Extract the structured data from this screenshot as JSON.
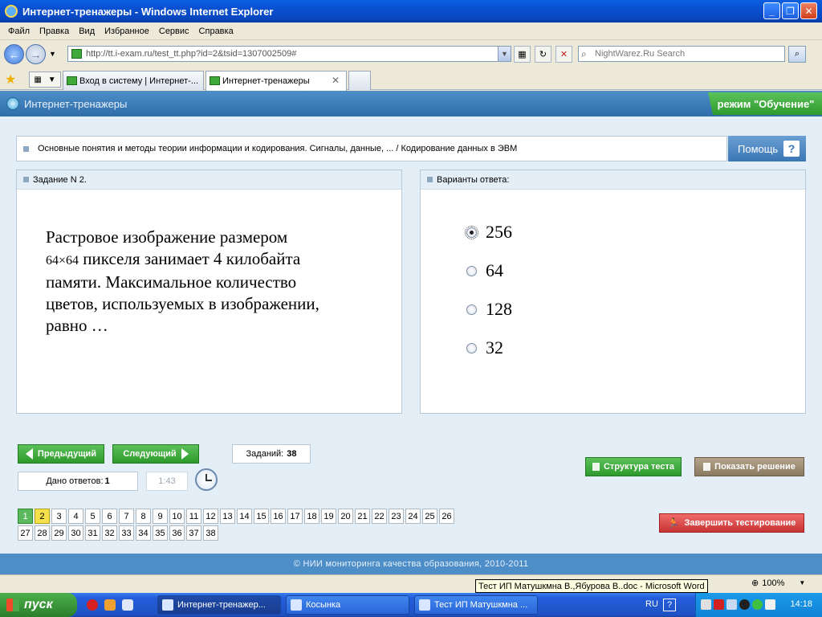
{
  "window": {
    "title": "Интернет-тренажеры - Windows Internet Explorer"
  },
  "menu": [
    "Файл",
    "Правка",
    "Вид",
    "Избранное",
    "Сервис",
    "Справка"
  ],
  "address": {
    "url": "http://tt.i-exam.ru/test_tt.php?id=2&tsid=1307002509#"
  },
  "search": {
    "placeholder": "NightWarez.Ru Search"
  },
  "tabs": [
    {
      "label": "Вход в систему | Интернет-..."
    },
    {
      "label": "Интернет-тренажеры"
    }
  ],
  "app": {
    "title": "Интернет-тренажеры",
    "mode": "режим \"Обучение\"",
    "breadcrumb": "Основные понятия и методы теории информации и кодирования. Сигналы, данные, ... / Кодирование данных в ЭВМ",
    "help": "Помощь",
    "help_icon": "?"
  },
  "task": {
    "header": "Задание N 2.",
    "text_line1": "Растровое изображение размером",
    "dim": "64×64",
    "text_rest1": " пикселя занимает 4 килобайта",
    "text_line3": "памяти. Максимальное количество",
    "text_line4": "цветов, используемых в изображении,",
    "text_line5": "равно …"
  },
  "answers": {
    "header": "Варианты ответа:",
    "options": [
      {
        "label": "256",
        "checked": true
      },
      {
        "label": "64",
        "checked": false
      },
      {
        "label": "128",
        "checked": false
      },
      {
        "label": "32",
        "checked": false
      }
    ]
  },
  "controls": {
    "prev": "Предыдущий",
    "next": "Следующий",
    "tasks_label": "Заданий:",
    "tasks_count": "38",
    "answered_label": "Дано ответов:",
    "answered_count": "1",
    "timer": "1:43",
    "structure": "Структура теста",
    "solution": "Показать решение",
    "finish": "Завершить тестирование"
  },
  "numbers": {
    "row1": [
      "1",
      "2",
      "3",
      "4",
      "5",
      "6",
      "7",
      "8",
      "9",
      "10",
      "11",
      "12",
      "13",
      "14",
      "15",
      "16",
      "17",
      "18",
      "19",
      "20",
      "21",
      "22",
      "23",
      "24",
      "25",
      "26"
    ],
    "row2": [
      "27",
      "28",
      "29",
      "30",
      "31",
      "32",
      "33",
      "34",
      "35",
      "36",
      "37",
      "38"
    ],
    "done": "1",
    "current": "2"
  },
  "footer": {
    "copyright": "© НИИ мониторинга качества образования, 2010-2011"
  },
  "statusbar": {
    "tooltip": "Тест ИП Матушкмна В.,Ябурова В..doc - Microsoft Word",
    "zoom": "100%"
  },
  "taskbar": {
    "start": "пуск",
    "items": [
      "Интернет-тренажер...",
      "Косынка",
      "Тест ИП Матушкмна ..."
    ],
    "lang": "RU",
    "help": "?",
    "time": "14:18"
  }
}
